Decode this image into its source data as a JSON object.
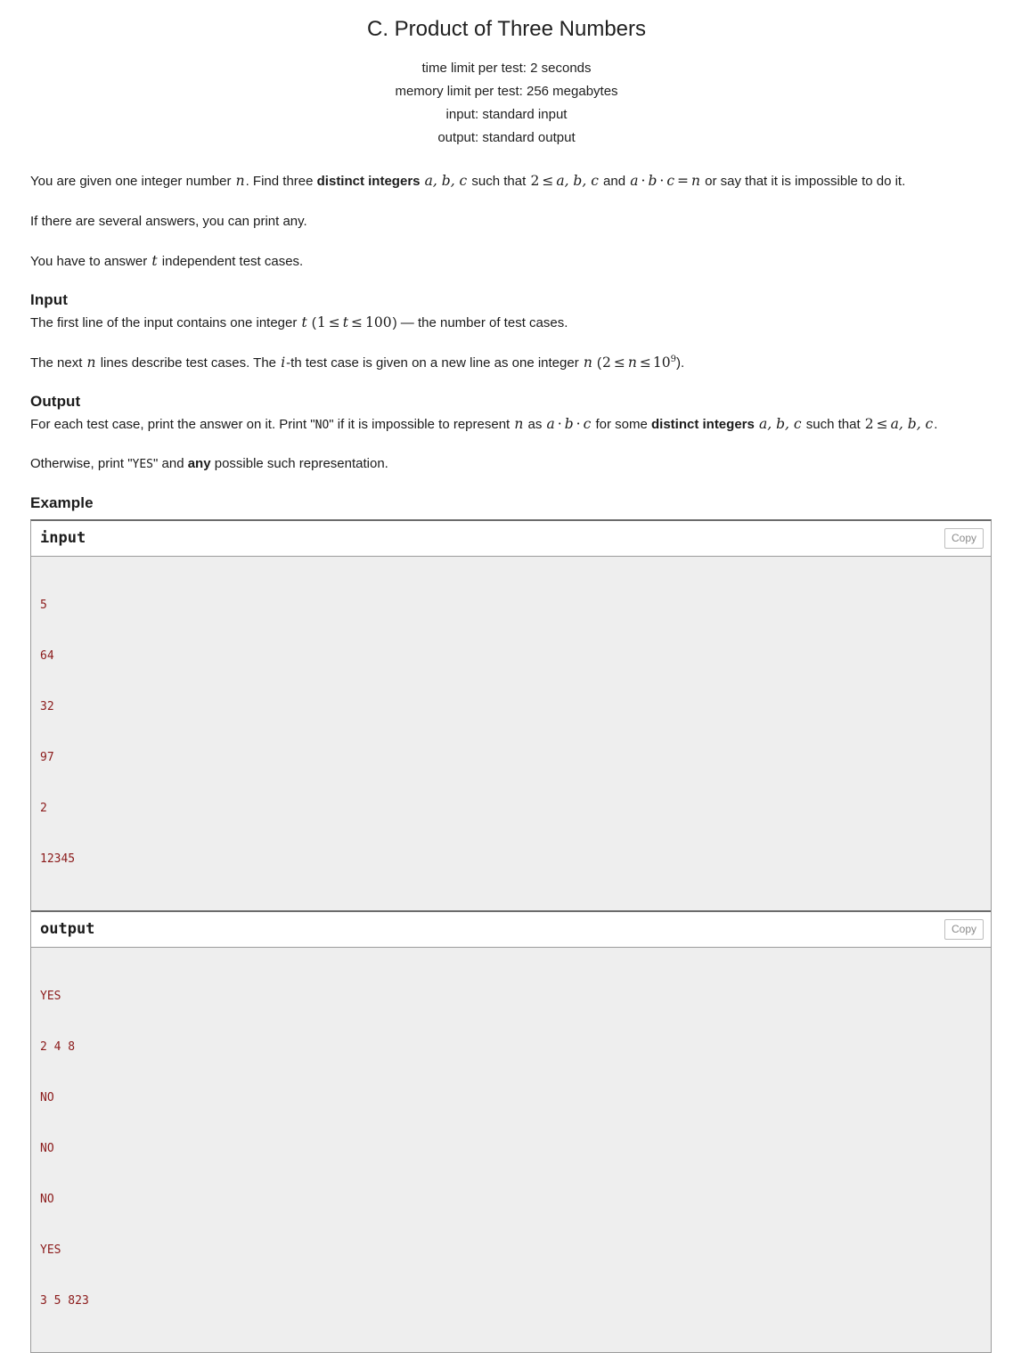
{
  "header": {
    "title": "C. Product of Three Numbers",
    "limits": [
      "time limit per test: 2 seconds",
      "memory limit per test: 256 megabytes",
      "input: standard input",
      "output: standard output"
    ]
  },
  "statement": {
    "p1": {
      "t1": "You are given one integer number ",
      "m1": "n",
      "t2": ". Find three ",
      "b1": "distinct integers",
      "t3": " ",
      "m2": "a, b, c",
      "t4": " such that ",
      "m3": "2",
      "op1": "≤",
      "m4": "a, b, c",
      "t5": " and ",
      "m5": "a",
      "op2": "·",
      "m6": "b",
      "op3": "·",
      "m7": "c",
      "op4": "=",
      "m8": "n",
      "t6": " or say that it is impossible to do it."
    },
    "p2": "If there are several answers, you can print any.",
    "p3": {
      "t1": "You have to answer ",
      "m1": "t",
      "t2": " independent test cases."
    }
  },
  "input_section": {
    "title": "Input",
    "line1": {
      "t1": "The first line of the input contains one integer ",
      "m1": "t",
      "t2": " (",
      "m2": "1",
      "op1": "≤",
      "m3": "t",
      "op2": "≤",
      "m4": "100",
      "t3": ") — the number of test cases."
    },
    "line2": {
      "t1": "The next ",
      "m1": "n",
      "t2": " lines describe test cases. The ",
      "m2": "i",
      "t3": "-th test case is given on a new line as one integer ",
      "m3": "n",
      "t4": " (",
      "m4": "2",
      "op1": "≤",
      "m5": "n",
      "op2": "≤",
      "m6": "10",
      "m6sup": "9",
      "t5": ")."
    }
  },
  "output_section": {
    "title": "Output",
    "line1": {
      "t1": "For each test case, print the answer on it. Print \"",
      "tt1": "NO",
      "t2": "\" if it is impossible to represent ",
      "m1": "n",
      "t3": " as ",
      "m2": "a",
      "op1": "·",
      "m3": "b",
      "op2": "·",
      "m4": "c",
      "t4": " for some ",
      "b1": "distinct integers",
      "t5": " ",
      "m5": "a, b, c",
      "t6": " such that ",
      "m6": "2",
      "op3": "≤",
      "m7": "a, b, c",
      "t7": "."
    },
    "line2": {
      "t1": "Otherwise, print \"",
      "tt1": "YES",
      "t2": "\" and ",
      "b1": "any",
      "t3": " possible such representation."
    }
  },
  "example": {
    "title": "Example",
    "blocks": [
      {
        "label": "input",
        "copy_label": "Copy",
        "lines": [
          "5",
          "64",
          "32",
          "97",
          "2",
          "12345"
        ]
      },
      {
        "label": "output",
        "copy_label": "Copy",
        "lines": [
          "YES",
          "2 4 8",
          "NO",
          "NO",
          "NO",
          "YES",
          "3 5 823"
        ]
      }
    ]
  },
  "colors": {
    "sample_text": "#8b1a1a",
    "sample_bg": "#eeeeee",
    "border": "#9c9c9c",
    "text": "#1b1b1b"
  }
}
